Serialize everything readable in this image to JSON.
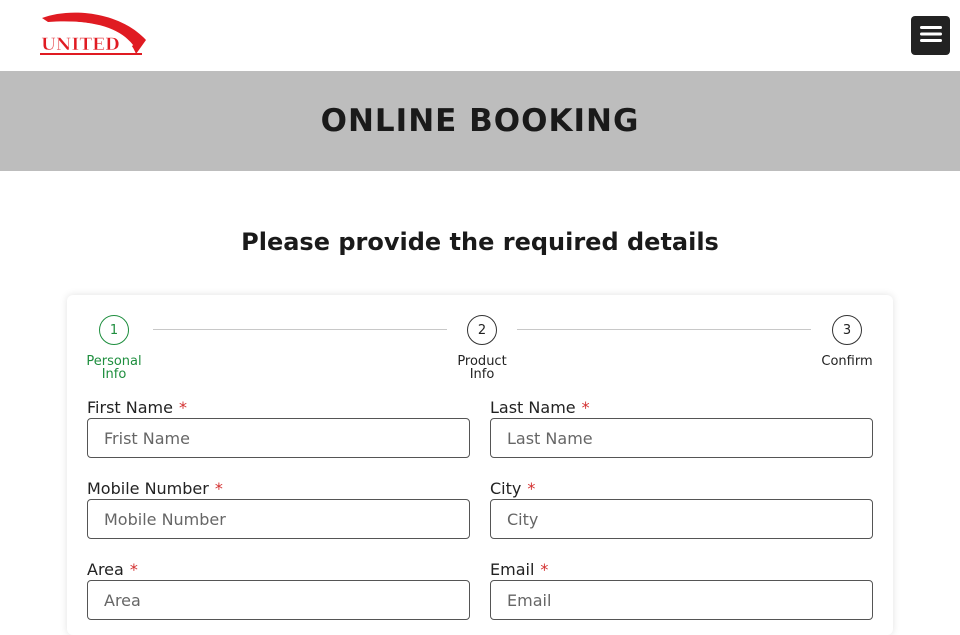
{
  "header": {
    "logo_text": "UNITED",
    "menu_icon": "hamburger-menu-icon"
  },
  "banner": {
    "title": "ONLINE BOOKING"
  },
  "main": {
    "subtitle": "Please provide the required details"
  },
  "steps": [
    {
      "number": "1",
      "label": "Personal Info",
      "active": true
    },
    {
      "number": "2",
      "label": "Product Info",
      "active": false
    },
    {
      "number": "3",
      "label": "Confirm",
      "active": false
    }
  ],
  "form": {
    "required_marker": "*",
    "first_name": {
      "label": "First Name",
      "placeholder": "Frist Name",
      "value": ""
    },
    "last_name": {
      "label": "Last Name",
      "placeholder": "Last Name",
      "value": ""
    },
    "mobile": {
      "label": "Mobile Number",
      "placeholder": "Mobile Number",
      "value": ""
    },
    "city": {
      "label": "City",
      "placeholder": "City",
      "value": ""
    },
    "area": {
      "label": "Area",
      "placeholder": "Area",
      "value": ""
    },
    "email": {
      "label": "Email",
      "placeholder": "Email",
      "value": ""
    }
  },
  "colors": {
    "brand_red": "#e01b22",
    "active_step": "#1e8e3e",
    "banner_bg": "#bdbdbd",
    "required": "#d32f2f"
  }
}
